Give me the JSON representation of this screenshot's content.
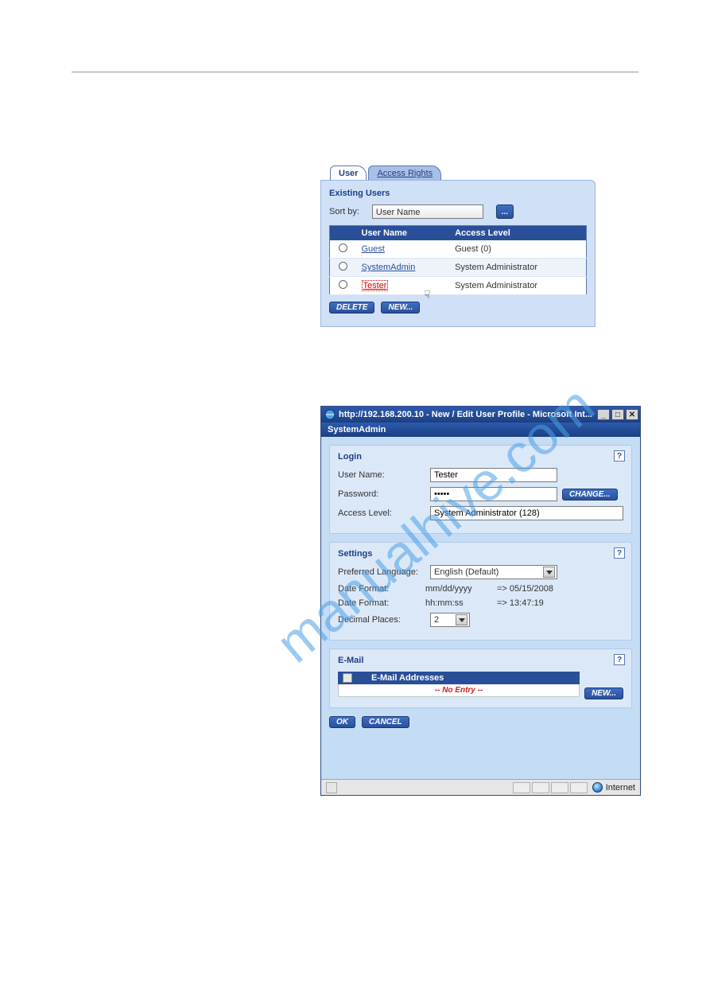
{
  "watermark": "manualhive.com",
  "users_panel": {
    "tabs": {
      "user": "User",
      "access_rights": "Access Rights"
    },
    "title": "Existing Users",
    "sort_label": "Sort by:",
    "sort_value": "User Name",
    "sort_button": "...",
    "columns": {
      "username": "User Name",
      "access": "Access Level"
    },
    "rows": [
      {
        "name": "Guest",
        "level": "Guest (0)"
      },
      {
        "name": "SystemAdmin",
        "level": "System Administrator"
      },
      {
        "name": "Tester",
        "level": "System Administrator"
      }
    ],
    "buttons": {
      "delete": "DELETE",
      "new": "NEW..."
    }
  },
  "ie": {
    "title": "http://192.168.200.10 - New / Edit User Profile - Microsoft Int...",
    "subheader": "SystemAdmin",
    "login": {
      "title": "Login",
      "username_label": "User Name:",
      "username_value": "Tester",
      "password_label": "Password:",
      "password_value": "•••••",
      "change_btn": "CHANGE...",
      "access_label": "Access Level:",
      "access_value": "System Administrator (128)"
    },
    "settings": {
      "title": "Settings",
      "lang_label": "Preferred Language:",
      "lang_value": "English (Default)",
      "date1_label": "Date Format:",
      "date1_fmt": "mm/dd/yyyy",
      "date1_ex": "=> 05/15/2008",
      "date2_label": "Date Format:",
      "date2_fmt": "hh:mm:ss",
      "date2_ex": "=> 13:47:19",
      "dec_label": "Decimal Places:",
      "dec_value": "2"
    },
    "email": {
      "title": "E-Mail",
      "header": "E-Mail Addresses",
      "no_entry": "-- No Entry --",
      "new_btn": "NEW..."
    },
    "ok": "OK",
    "cancel": "CANCEL",
    "status_zone": "Internet"
  }
}
